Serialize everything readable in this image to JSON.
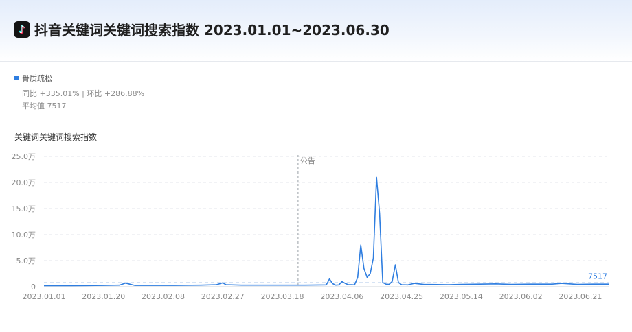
{
  "page": {
    "title": "抖音关键词关键词搜索指数 2023.01.01~2023.06.30",
    "logo_icon": "douyin-logo"
  },
  "summary": {
    "legend_label": "骨质疏松",
    "yoy_label": "同比",
    "yoy_value": "+335.01%",
    "mom_label": "环比",
    "mom_value": "+286.88%",
    "avg_label": "平均值",
    "avg_value": "7517"
  },
  "chart_data": {
    "type": "line",
    "title": "关键词关键词搜索指数",
    "ylim": [
      0,
      250000
    ],
    "y_ticks": [
      0,
      50000,
      100000,
      150000,
      200000,
      250000
    ],
    "y_tick_labels": [
      "0",
      "5.0万",
      "10.0万",
      "15.0万",
      "20.0万",
      "25.0万"
    ],
    "x_tick_labels": [
      "2023.01.01",
      "2023.01.20",
      "2023.02.08",
      "2023.02.27",
      "2023.03.18",
      "2023.04.06",
      "2023.04.25",
      "2023.05.14",
      "2023.06.02",
      "2023.06.21"
    ],
    "grid": true,
    "x_start": "2023-01-01",
    "x_end": "2023-06-30",
    "annotation": {
      "date": "2023-03-23",
      "label": "公告"
    },
    "average": {
      "value": 7517,
      "label": "7517"
    },
    "series": [
      {
        "name": "骨质疏松",
        "color": "#2f7ee0",
        "points": [
          [
            "2023-01-01",
            2000
          ],
          [
            "2023-01-10",
            2000
          ],
          [
            "2023-01-20",
            2500
          ],
          [
            "2023-01-25",
            3000
          ],
          [
            "2023-01-27",
            7000
          ],
          [
            "2023-01-28",
            5500
          ],
          [
            "2023-01-30",
            2500
          ],
          [
            "2023-02-10",
            2500
          ],
          [
            "2023-02-20",
            3000
          ],
          [
            "2023-02-25",
            4000
          ],
          [
            "2023-02-27",
            7500
          ],
          [
            "2023-02-28",
            4000
          ],
          [
            "2023-03-05",
            3000
          ],
          [
            "2023-03-15",
            3000
          ],
          [
            "2023-03-25",
            3000
          ],
          [
            "2023-04-01",
            3500
          ],
          [
            "2023-04-02",
            15000
          ],
          [
            "2023-04-03",
            6000
          ],
          [
            "2023-04-04",
            3000
          ],
          [
            "2023-04-05",
            3500
          ],
          [
            "2023-04-06",
            10000
          ],
          [
            "2023-04-07",
            6500
          ],
          [
            "2023-04-08",
            4000
          ],
          [
            "2023-04-09",
            4000
          ],
          [
            "2023-04-10",
            3500
          ],
          [
            "2023-04-11",
            18000
          ],
          [
            "2023-04-12",
            80000
          ],
          [
            "2023-04-13",
            35000
          ],
          [
            "2023-04-14",
            18000
          ],
          [
            "2023-04-15",
            25000
          ],
          [
            "2023-04-16",
            55000
          ],
          [
            "2023-04-17",
            210000
          ],
          [
            "2023-04-18",
            140000
          ],
          [
            "2023-04-19",
            8000
          ],
          [
            "2023-04-20",
            5000
          ],
          [
            "2023-04-21",
            4500
          ],
          [
            "2023-04-22",
            10000
          ],
          [
            "2023-04-23",
            42000
          ],
          [
            "2023-04-24",
            8000
          ],
          [
            "2023-04-25",
            4000
          ],
          [
            "2023-04-27",
            3500
          ],
          [
            "2023-04-29",
            6500
          ],
          [
            "2023-05-02",
            4500
          ],
          [
            "2023-05-10",
            4000
          ],
          [
            "2023-05-14",
            4500
          ],
          [
            "2023-05-20",
            5000
          ],
          [
            "2023-05-25",
            5500
          ],
          [
            "2023-05-30",
            4500
          ],
          [
            "2023-06-05",
            5000
          ],
          [
            "2023-06-12",
            5000
          ],
          [
            "2023-06-15",
            6500
          ],
          [
            "2023-06-20",
            4500
          ],
          [
            "2023-06-25",
            5000
          ],
          [
            "2023-06-30",
            5000
          ]
        ]
      }
    ]
  }
}
